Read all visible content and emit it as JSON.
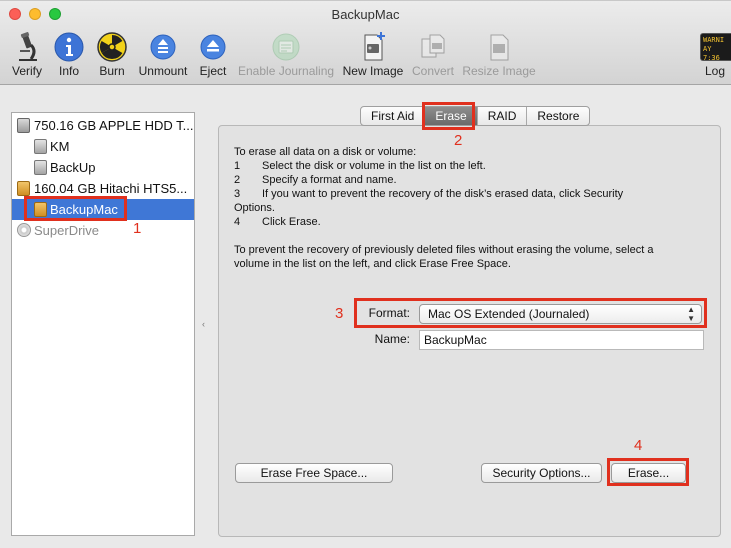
{
  "window": {
    "title": "BackupMac"
  },
  "colors": {
    "close": "#fc5f57",
    "minimize": "#fdbc2e",
    "zoom": "#28c840",
    "selection": "#3f77d6",
    "annotation": "#e0301e"
  },
  "toolbar": {
    "verify": "Verify",
    "info": "Info",
    "burn": "Burn",
    "unmount": "Unmount",
    "eject": "Eject",
    "enable_journaling": "Enable Journaling",
    "new_image": "New Image",
    "convert": "Convert",
    "resize_image": "Resize Image",
    "log": "Log",
    "log_badge_1": "WARNI",
    "log_badge_2": "AY 7:36"
  },
  "sidebar": {
    "items": [
      {
        "label": "750.16 GB APPLE HDD T...",
        "icon": "hard-disk-icon"
      },
      {
        "label": "KM",
        "icon": "volume-icon"
      },
      {
        "label": "BackUp",
        "icon": "volume-icon"
      },
      {
        "label": "160.04 GB Hitachi HTS5...",
        "icon": "external-disk-icon"
      },
      {
        "label": "BackupMac",
        "icon": "external-volume-icon",
        "selected": true
      },
      {
        "label": "SuperDrive",
        "icon": "optical-drive-icon"
      }
    ]
  },
  "tabs": [
    "First Aid",
    "Erase",
    "RAID",
    "Restore"
  ],
  "active_tab": "Erase",
  "erase": {
    "intro": "To erase all data on a disk or volume:",
    "steps": [
      {
        "num": "1",
        "text": "Select the disk or volume in the list on the left."
      },
      {
        "num": "2",
        "text": "Specify a format and name."
      },
      {
        "num": "3",
        "text": "If you want to prevent the recovery of the disk’s erased data, click Security"
      },
      {
        "num": "4",
        "text": "Click Erase."
      }
    ],
    "step3_cont": "Options.",
    "prevent1": "To prevent the recovery of previously deleted files without erasing the volume, select a",
    "prevent2": "volume in the list on the left, and click Erase Free Space.",
    "format_label": "Format:",
    "format_value": "Mac OS Extended (Journaled)",
    "name_label": "Name:",
    "name_value": "BackupMac",
    "erase_free_space": "Erase Free Space...",
    "security_options": "Security Options...",
    "erase_button": "Erase..."
  },
  "annotations": [
    "1",
    "2",
    "3",
    "4"
  ]
}
